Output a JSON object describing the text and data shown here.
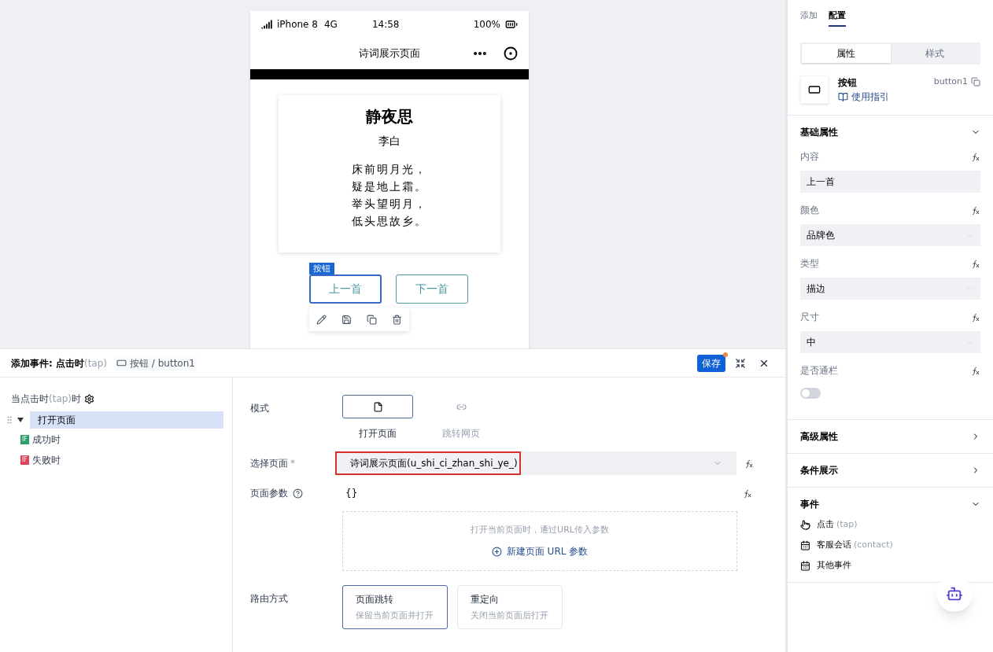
{
  "phone": {
    "status": {
      "carrier": "iPhone 8",
      "network": "4G",
      "time": "14:58",
      "battery": "100%"
    },
    "nav_title": "诗词展示页面",
    "poem": {
      "title": "静夜思",
      "author": "李白",
      "lines": [
        "床前明月光，",
        "疑是地上霜。",
        "举头望明月，",
        "低头思故乡。"
      ]
    },
    "selection_tag": "按钮",
    "buttons": [
      {
        "label": "上一首",
        "selected": true
      },
      {
        "label": "下一首",
        "selected": false
      }
    ]
  },
  "event_panel": {
    "title": "添加事件: 点击时",
    "title_hint": "(tap)",
    "breadcrumb": "按钮 / button1",
    "save": "保存",
    "unsaved": true,
    "trigger": {
      "label_start": "当点击时",
      "hint": "(tap)",
      "label_end": "时"
    },
    "actions": [
      {
        "label": "打开页面",
        "expanded": true,
        "selected": true,
        "children": [
          {
            "label": "成功时",
            "badge": "IF",
            "color": "#2e9e6b"
          },
          {
            "label": "失败时",
            "badge": "IF",
            "color": "#e0445a"
          }
        ]
      }
    ],
    "form": {
      "mode_label": "模式",
      "modes": [
        {
          "label": "打开页面",
          "kind": "page",
          "selected": true
        },
        {
          "label": "跳转网页",
          "kind": "link",
          "selected": false
        }
      ],
      "page_label": "选择页面",
      "required_mark": "*",
      "page_value": "诗词展示页面(u_shi_ci_zhan_shi_ye_)",
      "page_highlighted": true,
      "params_label": "页面参数",
      "params_value": "{}",
      "params_hint": "打开当前页面时，通过URL传入参数",
      "params_add": "新建页面 URL 参数",
      "route_label": "路由方式",
      "routes": [
        {
          "title": "页面跳转",
          "desc": "保留当前页面并打开",
          "selected": true
        },
        {
          "title": "重定向",
          "desc": "关闭当前页面后打开",
          "selected": false
        }
      ]
    }
  },
  "inspector": {
    "tabs": [
      {
        "label": "添加",
        "selected": false
      },
      {
        "label": "配置",
        "selected": true
      }
    ],
    "subtabs": [
      {
        "label": "属性",
        "selected": true
      },
      {
        "label": "样式",
        "selected": false
      }
    ],
    "component": {
      "name": "按钮",
      "guide": "使用指引",
      "id": "button1"
    },
    "sections": [
      {
        "title": "基础属性",
        "expanded": true,
        "fields": [
          {
            "kind": "input",
            "label": "内容",
            "value": "上一首"
          },
          {
            "kind": "select",
            "label": "颜色",
            "value": "品牌色"
          },
          {
            "kind": "select",
            "label": "类型",
            "value": "描边"
          },
          {
            "kind": "select",
            "label": "尺寸",
            "value": "中"
          },
          {
            "kind": "switch",
            "label": "是否通栏",
            "on": false
          }
        ]
      },
      {
        "title": "高级属性",
        "expanded": false
      },
      {
        "title": "条件展示",
        "expanded": false
      },
      {
        "title": "事件",
        "expanded": true,
        "events": [
          {
            "kind": "tap",
            "label": "点击",
            "hint": "(tap)"
          },
          {
            "kind": "calendar",
            "label": "客服会话",
            "hint": "(contact)"
          },
          {
            "kind": "calendar",
            "label": "其他事件"
          }
        ]
      }
    ]
  }
}
